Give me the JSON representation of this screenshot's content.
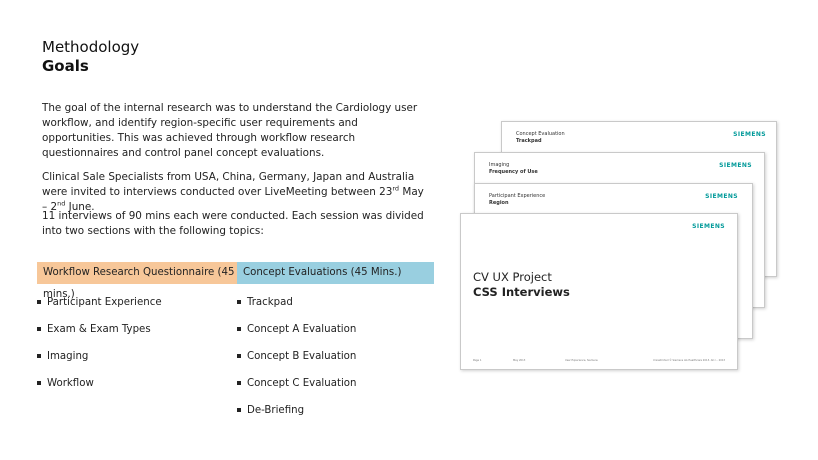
{
  "heading": {
    "line1": "Methodology",
    "line2": "Goals"
  },
  "paragraphs": {
    "p1": "The goal of the internal research was to understand the Cardiology user workflow, and identify region-specific user requirements and opportunities. This was achieved through workflow research questionnaires and control panel concept evaluations.",
    "p2_before": "Clinical Sale Specialists from USA, China, Germany, Japan and Australia were invited to interviews conducted over LiveMeeting between 23",
    "p2_sup1": "rd",
    "p2_mid": " May – 2",
    "p2_sup2": "nd",
    "p2_after": " June.",
    "p3": "11 interviews of 90 mins each were conducted. Each session was divided into two sections with the following topics:"
  },
  "sections": {
    "left": {
      "header": "Workflow Research Questionnaire (45 mins.)",
      "color": "#f7c799",
      "items": [
        "Participant Experience",
        "Exam & Exam Types",
        "Imaging",
        "Workflow"
      ]
    },
    "right": {
      "header": "Concept Evaluations (45 Mins.)",
      "color": "#99cfe0",
      "items": [
        "Trackpad",
        "Concept A Evaluation",
        "Concept B Evaluation",
        "Concept C Evaluation",
        "De-Briefing"
      ]
    }
  },
  "thumbnails": {
    "logo_text": "SIEMENS",
    "logo_color": "#009999",
    "slide4": {
      "label": "Concept Evaluation",
      "title": "Trackpad"
    },
    "slide3": {
      "label": "Imaging",
      "title": "Frequency of Use"
    },
    "slide2": {
      "label": "Participant Experience",
      "title": "Region"
    },
    "slide1": {
      "line1": "CV UX Project",
      "line2": "CSS Interviews",
      "footer": [
        "Page 1",
        "May 2013",
        "User Experience, Siemens",
        "Unrestricted © Siemens AG Healthcare 2013. All r... 2013"
      ]
    }
  }
}
